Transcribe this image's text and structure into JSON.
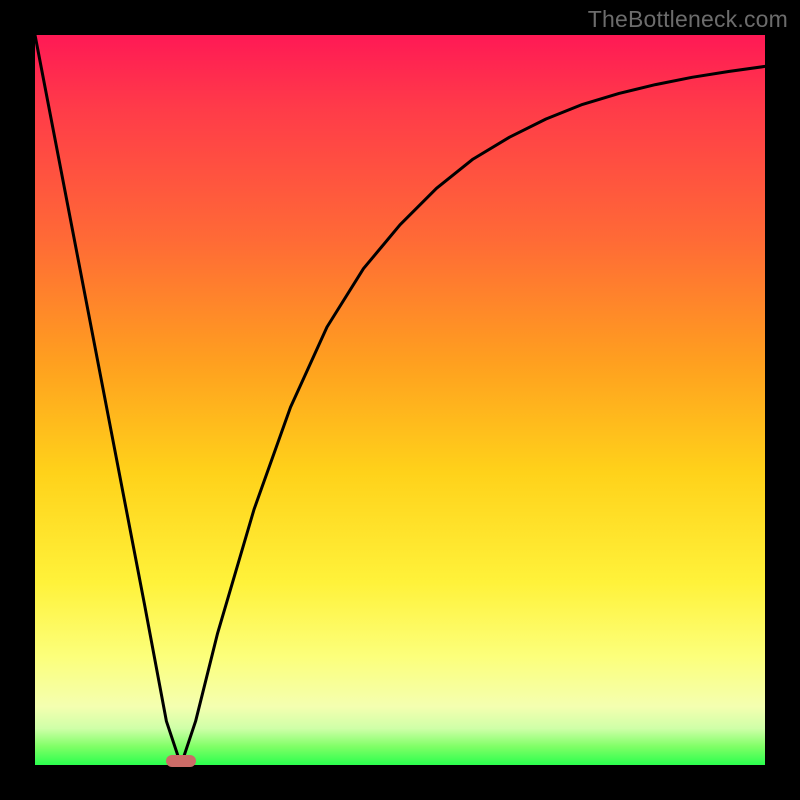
{
  "watermark": "TheBottleneck.com",
  "chart_data": {
    "type": "line",
    "title": "",
    "xlabel": "",
    "ylabel": "",
    "xlim": [
      0,
      100
    ],
    "ylim": [
      0,
      100
    ],
    "grid": false,
    "legend": false,
    "series": [
      {
        "name": "bottleneck-curve",
        "x": [
          0,
          5,
          10,
          15,
          18,
          20,
          22,
          25,
          30,
          35,
          40,
          45,
          50,
          55,
          60,
          65,
          70,
          75,
          80,
          85,
          90,
          95,
          100
        ],
        "y": [
          100,
          74,
          48,
          22,
          6,
          0,
          6,
          18,
          35,
          49,
          60,
          68,
          74,
          79,
          83,
          86,
          88.5,
          90.5,
          92,
          93.2,
          94.2,
          95,
          95.7
        ]
      }
    ],
    "optimal_marker": {
      "x_center": 20,
      "width_pct": 4
    },
    "background_gradient_stops": [
      {
        "pct": 0,
        "color": "#ff1955"
      },
      {
        "pct": 10,
        "color": "#ff3b49"
      },
      {
        "pct": 28,
        "color": "#ff6a36"
      },
      {
        "pct": 45,
        "color": "#ffa01f"
      },
      {
        "pct": 60,
        "color": "#ffd21a"
      },
      {
        "pct": 75,
        "color": "#fff23a"
      },
      {
        "pct": 85,
        "color": "#fcff7a"
      },
      {
        "pct": 92,
        "color": "#f4ffb0"
      },
      {
        "pct": 95,
        "color": "#cfffa8"
      },
      {
        "pct": 97.5,
        "color": "#7fff66"
      },
      {
        "pct": 100,
        "color": "#2bff4e"
      }
    ],
    "colors": {
      "curve": "#000000",
      "marker": "#cc6b67",
      "frame": "#000000"
    }
  }
}
